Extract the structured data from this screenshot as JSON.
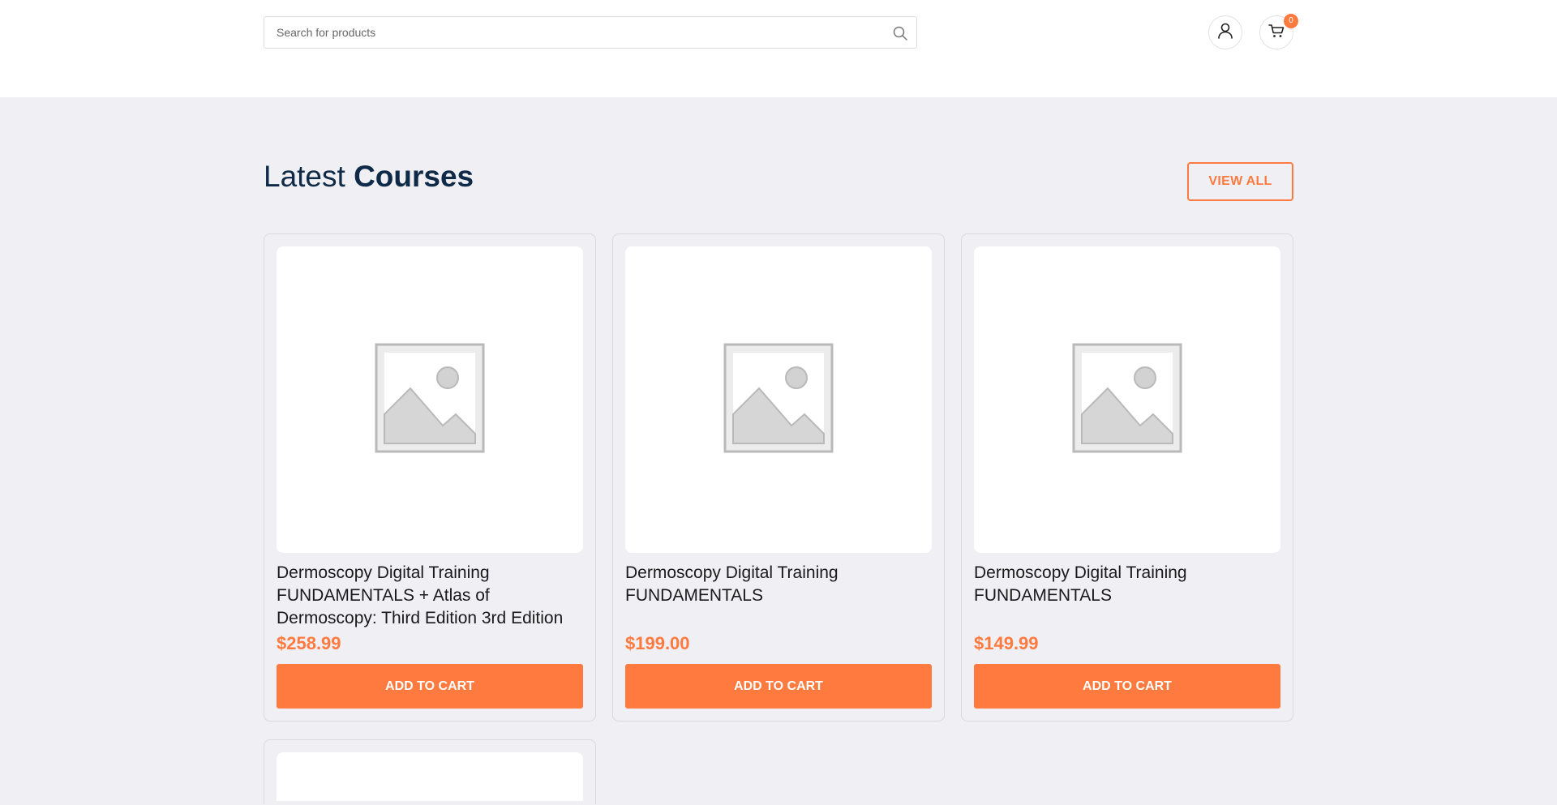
{
  "header": {
    "search_placeholder": "Search for products",
    "cart_count": "0"
  },
  "section": {
    "title_light": "Latest ",
    "title_bold": "Courses",
    "view_all_label": "VIEW ALL"
  },
  "products": [
    {
      "title": "Dermoscopy Digital Training FUNDAMENTALS + Atlas of Dermoscopy: Third Edition 3rd Edition",
      "price": "$258.99",
      "button_label": "ADD TO CART"
    },
    {
      "title": "Dermoscopy Digital Training FUNDAMENTALS",
      "price": "$199.00",
      "button_label": "ADD TO CART"
    },
    {
      "title": "Dermoscopy Digital Training FUNDAMENTALS",
      "price": "$149.99",
      "button_label": "ADD TO CART"
    }
  ],
  "colors": {
    "accent": "#ff7a3f",
    "heading": "#0f2a47",
    "page_bg": "#efeff4"
  }
}
